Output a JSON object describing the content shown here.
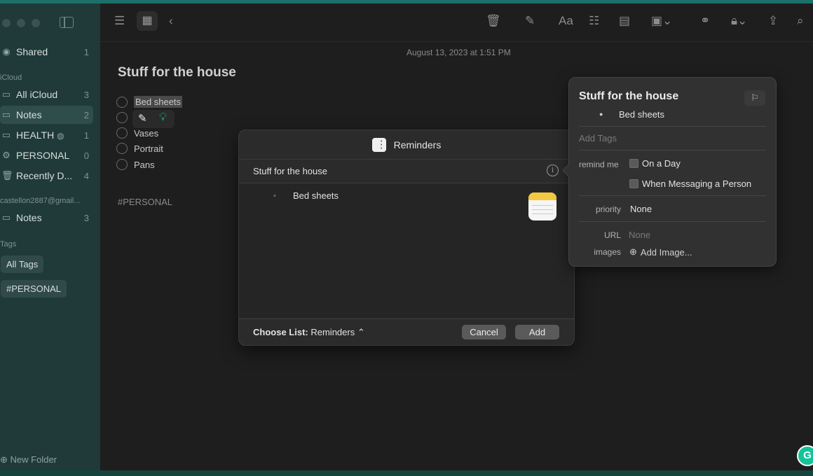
{
  "sidebar": {
    "shared": {
      "label": "Shared",
      "count": "1"
    },
    "icloud_header": "iCloud",
    "icloud_items": [
      {
        "label": "All iCloud",
        "count": "3"
      },
      {
        "label": "Notes",
        "count": "2"
      },
      {
        "label": "HEALTH",
        "count": "1"
      },
      {
        "label": "PERSONAL",
        "count": "0"
      },
      {
        "label": "Recently D...",
        "count": "4"
      }
    ],
    "account_header": "castellon2887@gmail...",
    "account_items": [
      {
        "label": "Notes",
        "count": "3"
      }
    ],
    "tags_header": "Tags",
    "tags": [
      "All Tags",
      "#PERSONAL"
    ],
    "new_folder": "New Folder"
  },
  "note": {
    "date": "August 13, 2023 at 1:51 PM",
    "title": "Stuff for the house",
    "checklist": [
      "Bed sheets",
      "",
      "Vases",
      "Portrait",
      "Pans"
    ],
    "tag": "#PERSONAL"
  },
  "dialog": {
    "header": "Reminders",
    "title": "Stuff for the house",
    "bullet": "Bed sheets",
    "choose_label": "Choose List:",
    "choose_value": "Reminders ⌃",
    "cancel": "Cancel",
    "add": "Add"
  },
  "popover": {
    "title": "Stuff for the house",
    "bullet": "Bed sheets",
    "add_tags": "Add Tags",
    "remind_me_label": "remind me",
    "on_a_day": "On a Day",
    "when_messaging": "When Messaging a Person",
    "priority_label": "priority",
    "priority_value": "None",
    "url_label": "URL",
    "url_value": "None",
    "images_label": "images",
    "add_image": "Add Image..."
  },
  "colors": {
    "sidebar_bg": "#1f3a38",
    "accent": "#1d6f69",
    "note_bg": "#1e1e1e",
    "dialog_bg": "#2b2b2b"
  }
}
